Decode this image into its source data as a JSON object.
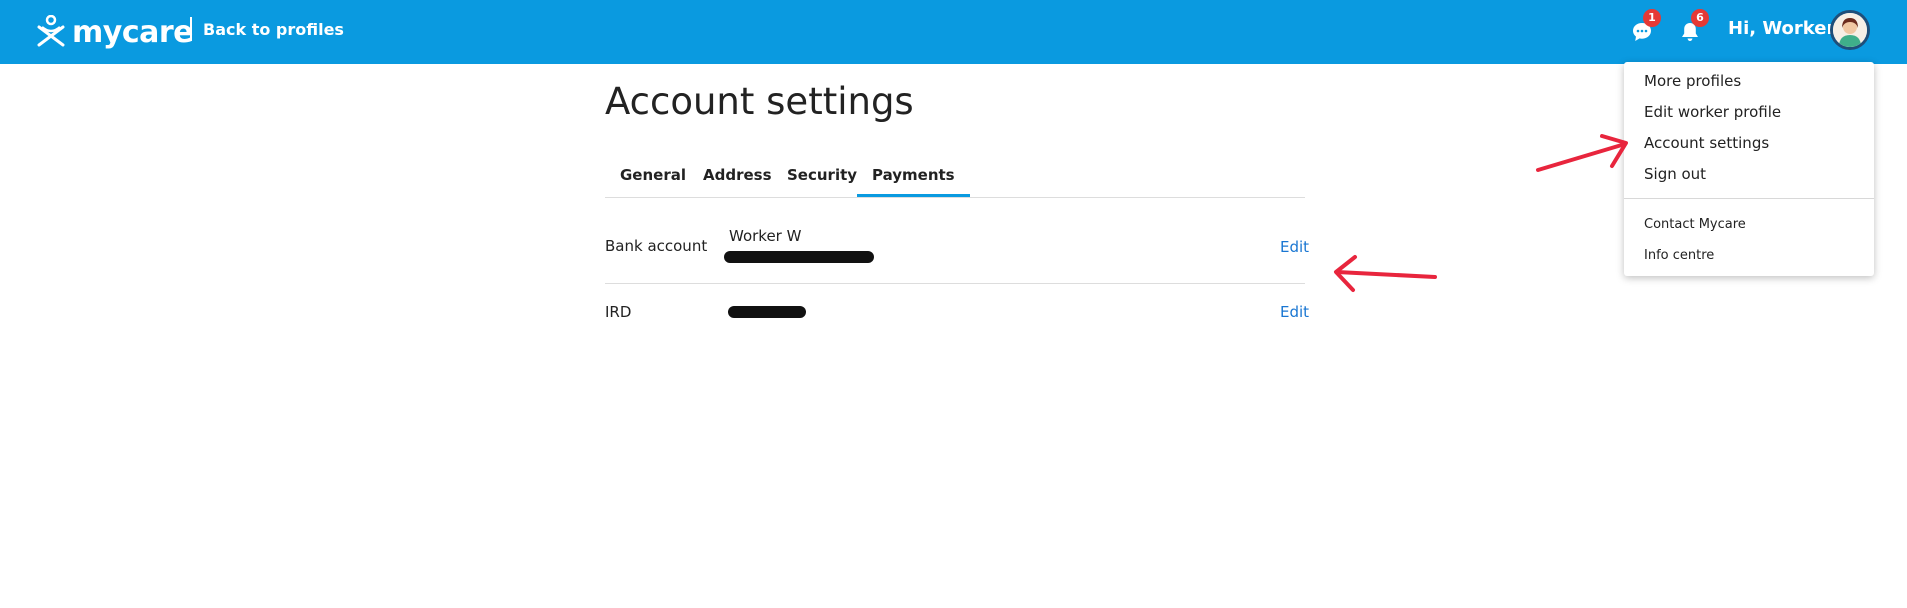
{
  "brand": {
    "name": "mycare",
    "color": "#0a9ae0"
  },
  "header": {
    "back_link": "Back to profiles",
    "messages_badge": "1",
    "notifications_badge": "6",
    "greeting": "Hi, Worker",
    "icons": [
      "chat-icon",
      "bell-icon",
      "avatar"
    ]
  },
  "main": {
    "title": "Account settings",
    "tabs": [
      {
        "label": "General",
        "active": false
      },
      {
        "label": "Address",
        "active": false
      },
      {
        "label": "Security",
        "active": false
      },
      {
        "label": "Payments",
        "active": true
      }
    ],
    "rows": [
      {
        "label": "Bank account",
        "value": "Worker W",
        "redacted": true,
        "action": "Edit"
      },
      {
        "label": "IRD",
        "value": "",
        "redacted": true,
        "action": "Edit"
      }
    ]
  },
  "dropdown": {
    "items": [
      "More profiles",
      "Edit worker profile",
      "Account settings",
      "Sign out"
    ],
    "secondary_items": [
      "Contact Mycare",
      "Info centre"
    ]
  },
  "annotations": {
    "arrow_color": "#e8253d"
  }
}
